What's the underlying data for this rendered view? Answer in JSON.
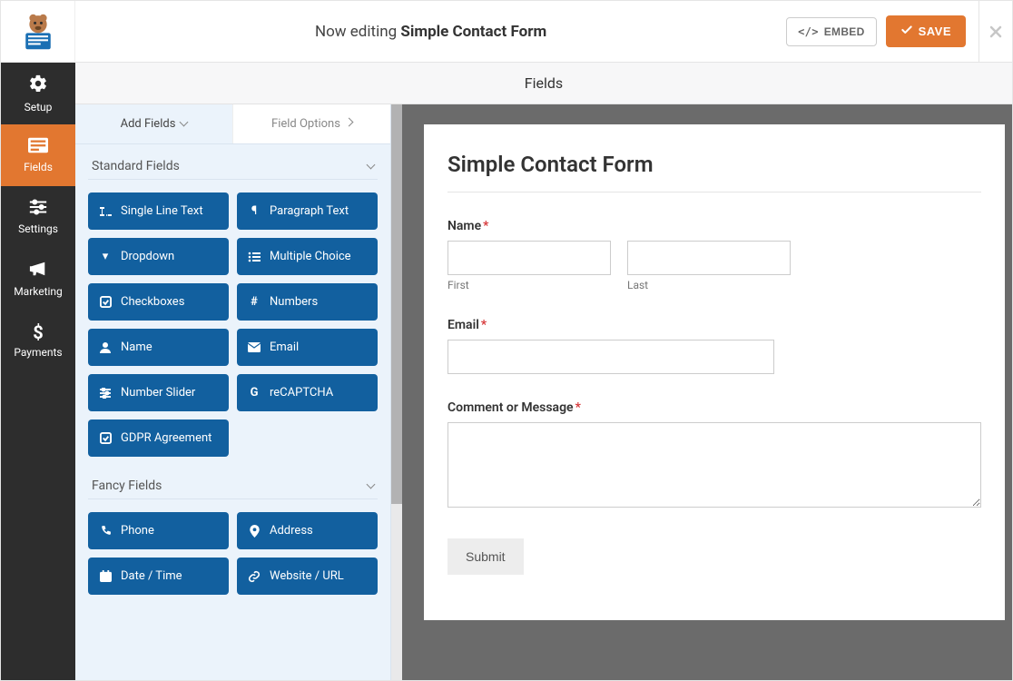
{
  "topbar": {
    "editing_prefix": "Now editing",
    "form_name": "Simple Contact Form",
    "embed_label": "EMBED",
    "save_label": "SAVE"
  },
  "nav": {
    "items": [
      {
        "id": "setup",
        "label": "Setup"
      },
      {
        "id": "fields",
        "label": "Fields"
      },
      {
        "id": "settings",
        "label": "Settings"
      },
      {
        "id": "marketing",
        "label": "Marketing"
      },
      {
        "id": "payments",
        "label": "Payments"
      }
    ],
    "active": "fields"
  },
  "panel_title": "Fields",
  "sidepanel": {
    "tabs": {
      "add_fields": "Add Fields",
      "field_options": "Field Options"
    },
    "sections": [
      {
        "title": "Standard Fields",
        "items": [
          {
            "icon": "text-width",
            "label": "Single Line Text"
          },
          {
            "icon": "paragraph",
            "label": "Paragraph Text"
          },
          {
            "icon": "caret-down",
            "label": "Dropdown"
          },
          {
            "icon": "list",
            "label": "Multiple Choice"
          },
          {
            "icon": "check-sq",
            "label": "Checkboxes"
          },
          {
            "icon": "hash",
            "label": "Numbers"
          },
          {
            "icon": "user",
            "label": "Name"
          },
          {
            "icon": "envelope",
            "label": "Email"
          },
          {
            "icon": "sliders",
            "label": "Number Slider"
          },
          {
            "icon": "recaptcha",
            "label": "reCAPTCHA"
          },
          {
            "icon": "check-sq",
            "label": "GDPR Agreement"
          }
        ]
      },
      {
        "title": "Fancy Fields",
        "items": [
          {
            "icon": "phone",
            "label": "Phone"
          },
          {
            "icon": "marker",
            "label": "Address"
          },
          {
            "icon": "calendar",
            "label": "Date / Time"
          },
          {
            "icon": "link",
            "label": "Website / URL"
          }
        ]
      }
    ]
  },
  "preview": {
    "title": "Simple Contact Form",
    "fields": {
      "name": {
        "label": "Name",
        "required": true,
        "sub_first": "First",
        "sub_last": "Last"
      },
      "email": {
        "label": "Email",
        "required": true
      },
      "comment": {
        "label": "Comment or Message",
        "required": true
      }
    },
    "submit_label": "Submit"
  }
}
